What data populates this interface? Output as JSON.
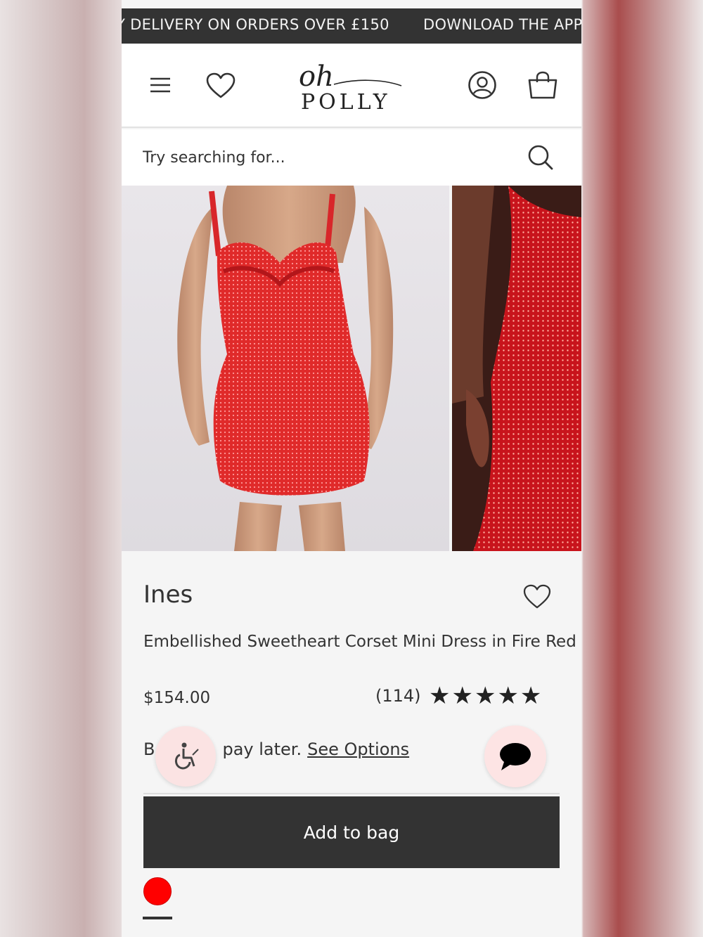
{
  "promo": {
    "left_text": "Y DELIVERY ON ORDERS OVER £150",
    "right_text": "DOWNLOAD THE APP"
  },
  "header": {
    "logo_script": "oh",
    "logo_word": "POLLY",
    "icons": [
      "menu-icon",
      "heart-icon",
      "account-icon",
      "bag-icon"
    ]
  },
  "search": {
    "placeholder": "Try searching for..."
  },
  "product": {
    "name": "Ines",
    "description": "Embellished Sweetheart Corset Mini Dress in Fire Red",
    "price": "$154.00",
    "review_count": "(114)",
    "stars": "★★★★★",
    "pay_prefix": "B",
    "pay_suffix": "pay later.",
    "pay_link": "See Options",
    "add_button": "Add to bag",
    "swatch_color": "#ff0000"
  },
  "colors": {
    "promo_bg": "#333333",
    "button_bg": "#333333",
    "fab_bg": "#fbe3e3"
  }
}
